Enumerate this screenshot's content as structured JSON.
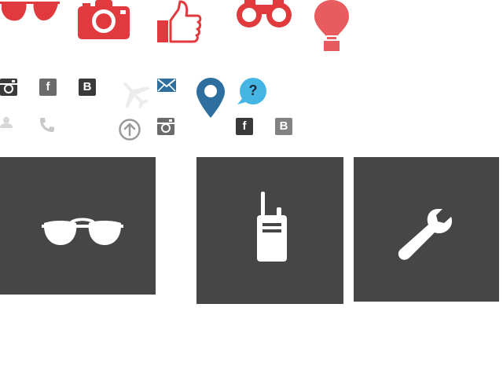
{
  "colors": {
    "red": "#e03a3e",
    "balloon": "#e85c5f",
    "blue": "#2e6fa0",
    "sky": "#45b5e3",
    "dark": "#3a3a3a",
    "tile": "#464646",
    "light_gray": "#bdbdbd",
    "gray": "#9a9a9a"
  },
  "top_icons": [
    "sunglasses-icon",
    "camera-icon",
    "thumbs-up-icon",
    "binoculars-icon",
    "hot-air-balloon-icon"
  ],
  "small_icons": [
    "instagram-icon",
    "facebook-icon",
    "bebo-icon",
    "airplane-icon",
    "mail-icon",
    "map-pin-icon",
    "help-bubble-icon",
    "user-icon",
    "phone-icon",
    "upload-icon",
    "instagram-icon",
    "facebook-icon",
    "bebo-icon"
  ],
  "badges": {
    "facebook": "f",
    "bebo": "B",
    "help": "?"
  },
  "tiles": [
    "sunglasses-icon",
    "walkie-talkie-icon",
    "wrench-icon"
  ]
}
